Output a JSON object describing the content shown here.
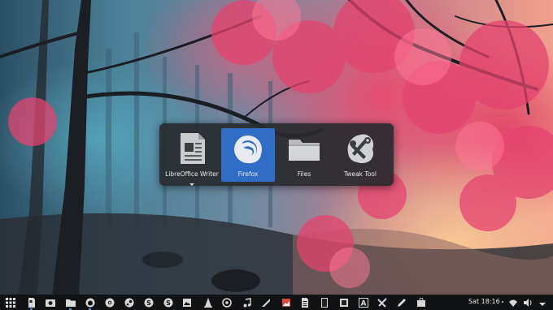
{
  "switcher": {
    "apps": [
      {
        "label": "LibreOffice Writer",
        "icon": "libreoffice-writer-icon",
        "selected": false,
        "has_multiple_windows": true
      },
      {
        "label": "Firefox",
        "icon": "firefox-icon",
        "selected": true,
        "has_multiple_windows": false
      },
      {
        "label": "Files",
        "icon": "files-folder-icon",
        "selected": false,
        "has_multiple_windows": false
      },
      {
        "label": "Tweak Tool",
        "icon": "tweak-tool-icon",
        "selected": false,
        "has_multiple_windows": false
      }
    ],
    "selected_color": "#2f6dc7"
  },
  "taskbar": {
    "clock": "Sat 18:16",
    "items": [
      "app-grid-icon",
      "writer-icon",
      "screenshot-icon",
      "files-icon",
      "firefox-icon",
      "chrome-icon",
      "steam-icon",
      "skype-icon",
      "skype-icon",
      "image-viewer-icon",
      "vlc-icon",
      "settings-icon",
      "music-icon",
      "inkscape-icon",
      "photo-icon",
      "document-icon",
      "terminal-icon",
      "font-viewer-icon",
      "tweak-icon",
      "text-editor-icon",
      "software-icon",
      "wifi-icon",
      "volume-icon",
      "power-icon"
    ]
  }
}
